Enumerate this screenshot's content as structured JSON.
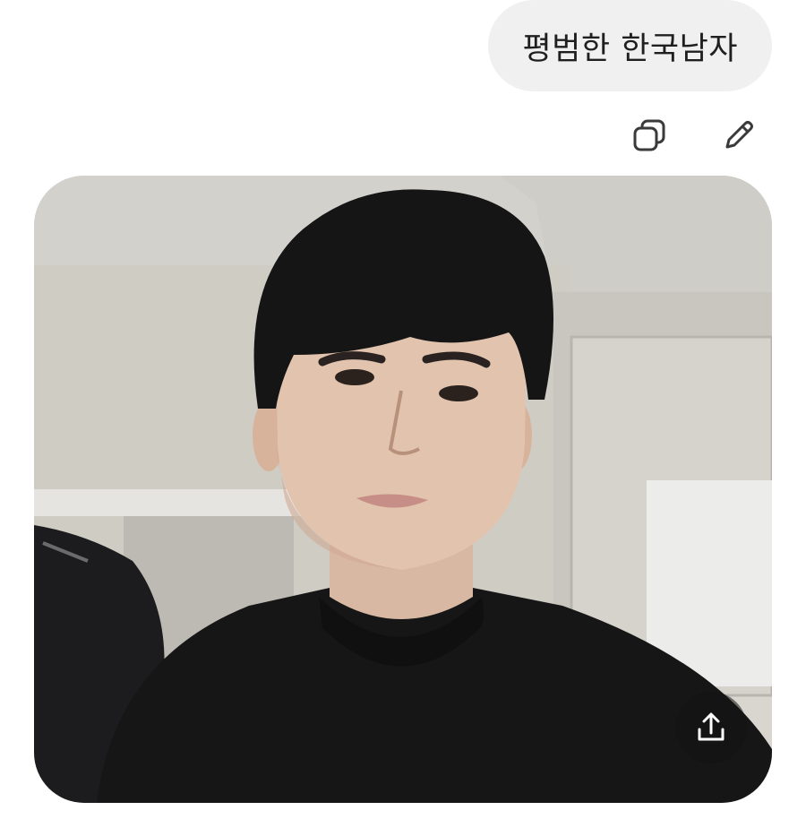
{
  "message": {
    "text": "평범한 한국남자"
  },
  "actions": {
    "copy_icon": "copy-icon",
    "edit_icon": "pencil-icon"
  },
  "image": {
    "share_icon": "share-upload-icon"
  },
  "colors": {
    "bubble_bg": "#f0f0f0",
    "text": "#1f1f1f",
    "icon": "#3a3a3a"
  }
}
